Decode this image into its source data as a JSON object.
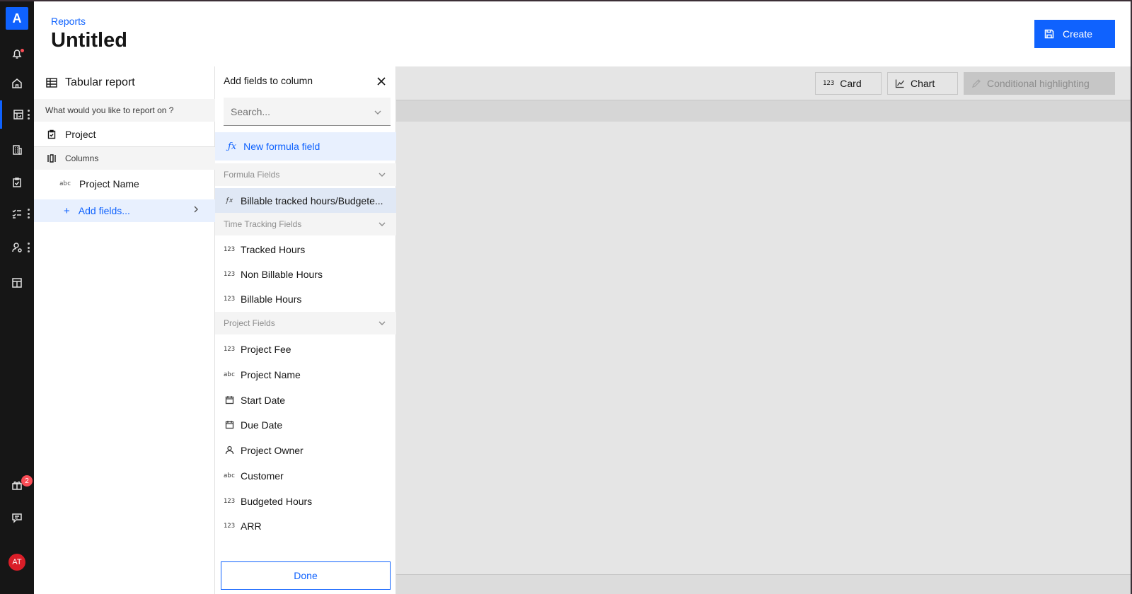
{
  "rail": {
    "logo": "A",
    "gift_badge": "2",
    "avatar": "AT"
  },
  "header": {
    "breadcrumb": "Reports",
    "title": "Untitled",
    "create_label": "Create"
  },
  "config": {
    "title": "Tabular report",
    "question": "What would you like to report on ?",
    "subject": "Project",
    "columns_label": "Columns",
    "column_items": [
      {
        "type": "abc",
        "label": "Project Name"
      }
    ],
    "add_fields_label": "Add fields..."
  },
  "picker": {
    "title": "Add fields to column",
    "search_placeholder": "Search...",
    "new_formula_label": "New formula field",
    "groups": [
      {
        "label": "Formula Fields"
      },
      {
        "label": "Time Tracking Fields"
      },
      {
        "label": "Project Fields"
      }
    ],
    "formula_fields": [
      {
        "type": "fx",
        "label": "Billable tracked hours/Budgete..."
      }
    ],
    "time_fields": [
      {
        "type": "123",
        "label": "Tracked Hours"
      },
      {
        "type": "123",
        "label": "Non Billable Hours"
      },
      {
        "type": "123",
        "label": "Billable Hours"
      }
    ],
    "project_fields": [
      {
        "type": "123",
        "label": "Project Fee"
      },
      {
        "type": "abc",
        "label": "Project Name"
      },
      {
        "type": "date",
        "label": "Start Date"
      },
      {
        "type": "date",
        "label": "Due Date"
      },
      {
        "type": "user",
        "label": "Project Owner"
      },
      {
        "type": "abc",
        "label": "Customer"
      },
      {
        "type": "123",
        "label": "Budgeted Hours"
      },
      {
        "type": "123",
        "label": "ARR"
      }
    ],
    "done_label": "Done"
  },
  "toolbar": {
    "card_label": "Card",
    "chart_label": "Chart",
    "highlight_label": "Conditional highlighting"
  },
  "colors": {
    "accent": "#0f62fe",
    "rail": "#161616",
    "canvas": "#e5e5e5",
    "alert": "#fa4d56"
  }
}
